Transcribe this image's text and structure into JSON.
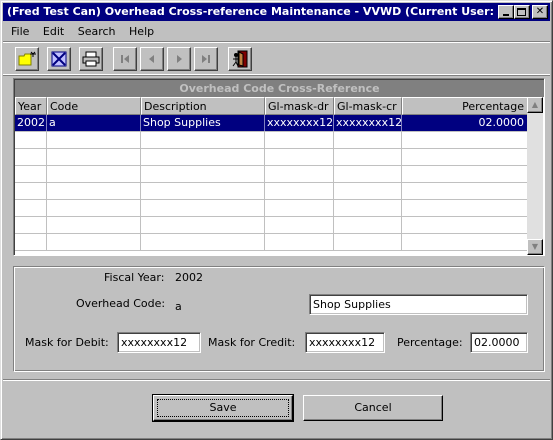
{
  "window": {
    "title": "(Fred Test Can) Overhead Cross-reference Maintenance - VVWD (Current User: s..."
  },
  "menu": {
    "items": [
      {
        "label": "File"
      },
      {
        "label": "Edit"
      },
      {
        "label": "Search"
      },
      {
        "label": "Help"
      }
    ]
  },
  "toolbar": {
    "icons": [
      "new-record-icon",
      "delete-record-icon",
      "print-icon",
      "first-record-icon",
      "previous-record-icon",
      "next-record-icon",
      "last-record-icon",
      "exit-icon"
    ]
  },
  "grid": {
    "title": "Overhead Code Cross-Reference",
    "columns": [
      "Year",
      "Code",
      "Description",
      "Gl-mask-dr",
      "Gl-mask-cr",
      "Percentage"
    ],
    "rows": [
      {
        "year": "2002",
        "code": "a",
        "description": "Shop Supplies",
        "gl_mask_dr": "xxxxxxxx12",
        "gl_mask_cr": "xxxxxxxx12",
        "percentage": "02.0000",
        "selected": true
      }
    ],
    "empty_rows": 7
  },
  "form": {
    "fiscal_year_label": "Fiscal Year:",
    "fiscal_year_value": "2002",
    "overhead_code_label": "Overhead Code:",
    "overhead_code_value": "a",
    "description_value": "Shop Supplies",
    "mask_debit_label": "Mask for Debit:",
    "mask_debit_value": "xxxxxxxx12",
    "mask_credit_label": "Mask for Credit:",
    "mask_credit_value": "xxxxxxxx12",
    "percentage_label": "Percentage:",
    "percentage_value": "02.0000"
  },
  "buttons": {
    "save_label": "Save",
    "cancel_label": "Cancel"
  },
  "colors": {
    "titlebar": "#000080",
    "selection": "#000080",
    "face": "#c0c0c0"
  }
}
